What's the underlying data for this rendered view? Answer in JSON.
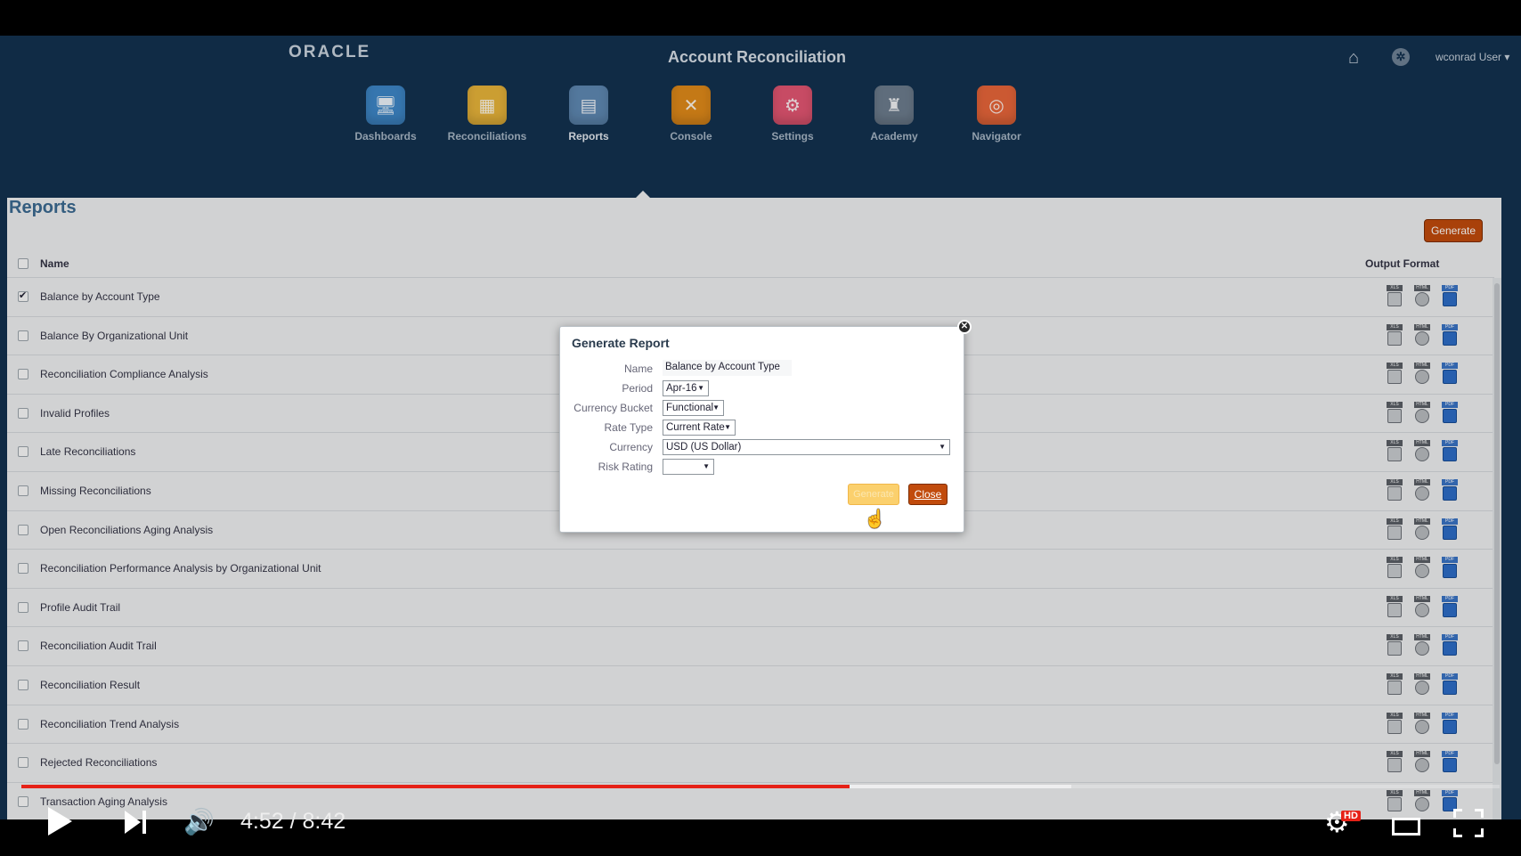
{
  "header": {
    "logo": "ORACLE",
    "title": "Account Reconciliation",
    "user": "wconrad User ▾"
  },
  "nav": [
    {
      "label": "Dashboards",
      "color": "#3e87c8",
      "glyph": "🖥"
    },
    {
      "label": "Reconciliations",
      "color": "#e8b43a",
      "glyph": "▦"
    },
    {
      "label": "Reports",
      "color": "#5f89b3",
      "glyph": "▤"
    },
    {
      "label": "Console",
      "color": "#e08a1a",
      "glyph": "✕"
    },
    {
      "label": "Settings",
      "color": "#e35672",
      "glyph": "⚙"
    },
    {
      "label": "Academy",
      "color": "#6d7d8e",
      "glyph": "♜"
    },
    {
      "label": "Navigator",
      "color": "#e8663a",
      "glyph": "◎"
    }
  ],
  "panel": {
    "title": "Reports",
    "generate_label": "Generate",
    "col_name": "Name",
    "col_format": "Output Format",
    "format_tags": {
      "xls": "XLS",
      "html": "HTML",
      "pdf": "PDF"
    },
    "rows": [
      {
        "name": "Balance by Account Type",
        "checked": true
      },
      {
        "name": "Balance By Organizational Unit",
        "checked": false
      },
      {
        "name": "Reconciliation Compliance Analysis",
        "checked": false
      },
      {
        "name": "Invalid Profiles",
        "checked": false
      },
      {
        "name": "Late Reconciliations",
        "checked": false
      },
      {
        "name": "Missing Reconciliations",
        "checked": false
      },
      {
        "name": "Open Reconciliations Aging Analysis",
        "checked": false
      },
      {
        "name": "Reconciliation Performance Analysis by Organizational Unit",
        "checked": false
      },
      {
        "name": "Profile Audit Trail",
        "checked": false
      },
      {
        "name": "Reconciliation Audit Trail",
        "checked": false
      },
      {
        "name": "Reconciliation Result",
        "checked": false
      },
      {
        "name": "Reconciliation Trend Analysis",
        "checked": false
      },
      {
        "name": "Rejected Reconciliations",
        "checked": false
      },
      {
        "name": "Transaction Aging Analysis",
        "checked": false
      }
    ]
  },
  "dialog": {
    "title": "Generate Report",
    "fields": {
      "name_label": "Name",
      "name_value": "Balance by Account Type",
      "period_label": "Period",
      "period_value": "Apr-16",
      "bucket_label": "Currency Bucket",
      "bucket_value": "Functional",
      "rate_label": "Rate Type",
      "rate_value": "Current Rate",
      "currency_label": "Currency",
      "currency_value": "USD (US Dollar)",
      "risk_label": "Risk Rating",
      "risk_value": ""
    },
    "generate_label": "Generate",
    "close_label": "Close"
  },
  "player": {
    "time": "4:52 / 8:42",
    "hd": "HD",
    "played_fraction": 0.56,
    "buffered_fraction": 0.71
  }
}
